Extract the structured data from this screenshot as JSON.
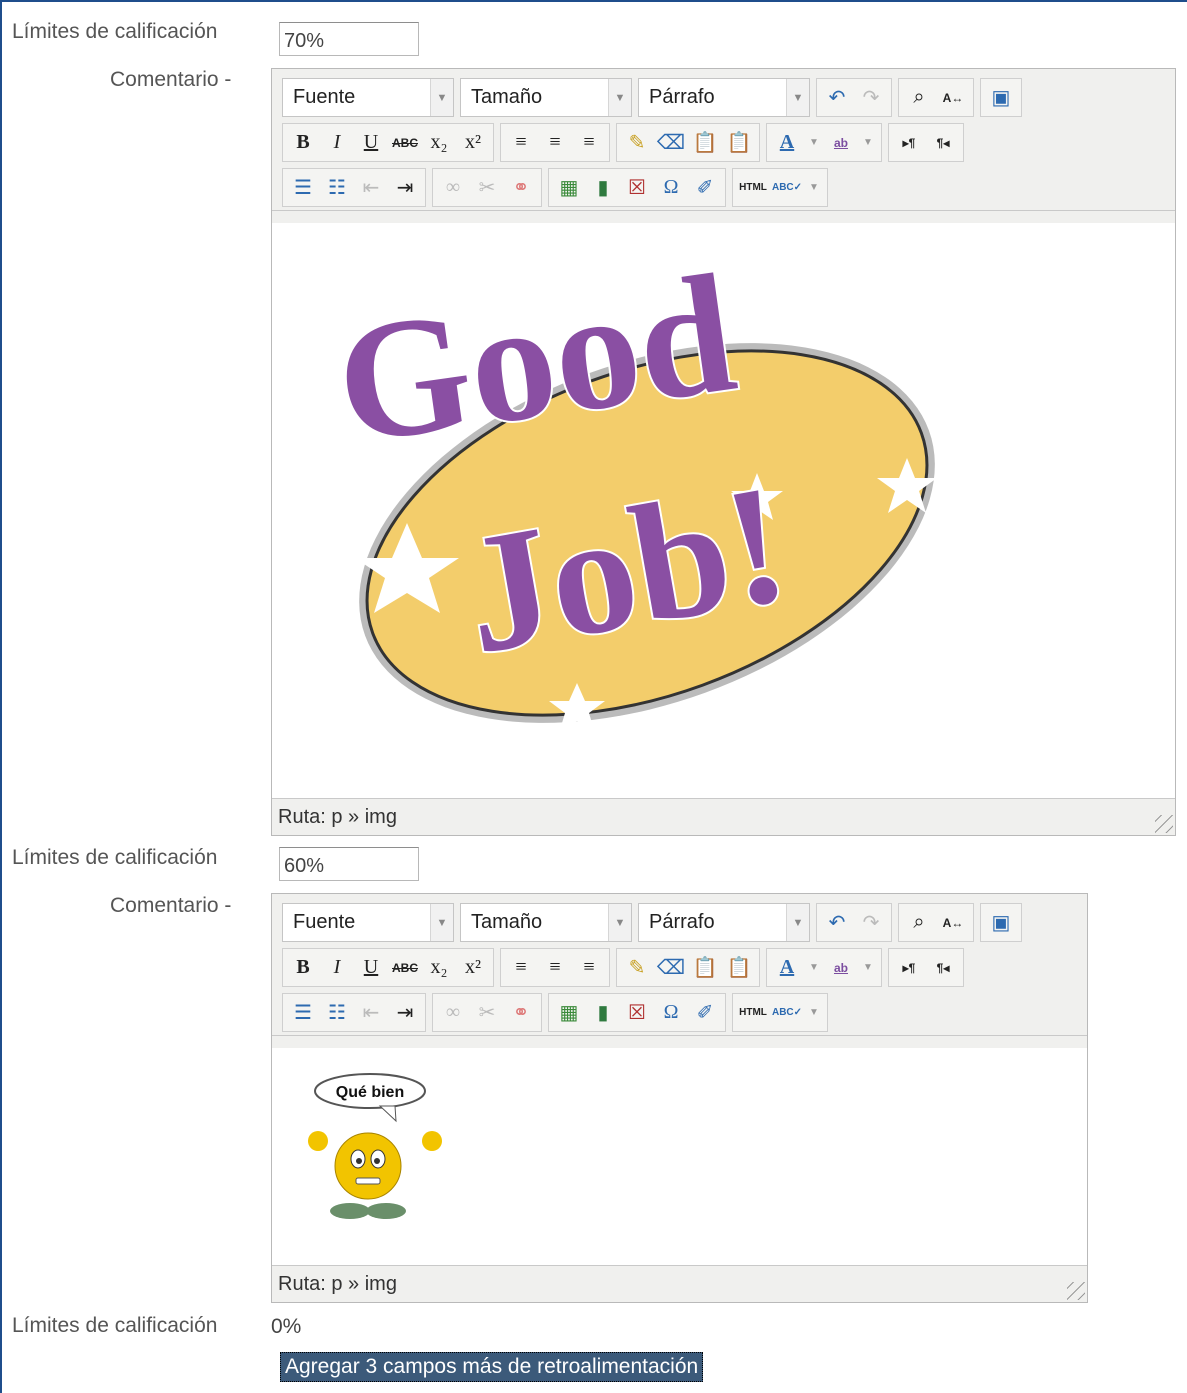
{
  "feedback_blocks": [
    {
      "grade_label": "Límites de calificación",
      "grade_value": "70%",
      "comment_label": "Comentario -",
      "editor": {
        "font_select": "Fuente",
        "size_select": "Tamaño",
        "format_select": "Párrafo",
        "path": "Ruta: p » img",
        "image_text_1": "Good",
        "image_text_2": "Job!"
      }
    },
    {
      "grade_label": "Límites de calificación",
      "grade_value": "60%",
      "comment_label": "Comentario -",
      "editor": {
        "font_select": "Fuente",
        "size_select": "Tamaño",
        "format_select": "Párrafo",
        "path": "Ruta: p » img",
        "image_text_1": "Qué bien"
      }
    }
  ],
  "final_grade": {
    "label": "Límites de calificación",
    "value": "0%"
  },
  "add_fields_button": "Agregar 3 campos más de retroalimentación",
  "colors": {
    "frame": "#1f4e8c",
    "button_bg": "#3c5a7a",
    "good_job_fill": "#f3cd6b",
    "good_job_text": "#8a4fa3"
  }
}
